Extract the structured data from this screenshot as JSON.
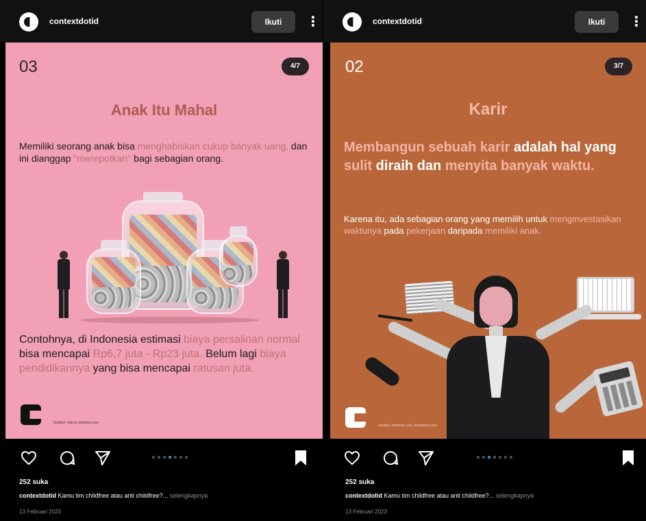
{
  "posts": [
    {
      "username": "contextdotid",
      "follow_label": "Ikuti",
      "more_glyph": "⋮",
      "slide_number": "03",
      "counter": "4/7",
      "title": "Anak Itu Mahal",
      "p1": [
        {
          "t": "Memiliki seorang anak bisa ",
          "hl": false
        },
        {
          "t": "menghabiskan cukup banyak uang,",
          "hl": true
        },
        {
          "t": " dan ini dianggap ",
          "hl": false
        },
        {
          "t": "\"merepotkan\"",
          "hl": true
        },
        {
          "t": " bagi sebagian orang.",
          "hl": false
        }
      ],
      "p2": [
        {
          "t": "Contohnya, di Indonesia estimasi ",
          "hl": false
        },
        {
          "t": "biaya persalinan normal",
          "hl": true
        },
        {
          "t": " bisa mencapai ",
          "hl": false
        },
        {
          "t": "Rp6,7 juta - Rp23 juta.",
          "hl": true
        },
        {
          "t": " Belum lagi ",
          "hl": false
        },
        {
          "t": "biaya pendidikannya",
          "hl": true
        },
        {
          "t": " yang bisa mencapai ",
          "hl": false
        },
        {
          "t": "ratusan juta.",
          "hl": true
        }
      ],
      "footnote": "Sumber: tirto.id, idntimes.com",
      "likes": "252 suka",
      "caption_user": "contextdotid",
      "caption_text": " Kamu tim childfree atau anti childfree?...",
      "caption_more": " selengkapnya",
      "date": "13 Februari 2023",
      "dots": 7,
      "active_dot": 3
    },
    {
      "username": "contextdotid",
      "follow_label": "Ikuti",
      "more_glyph": "⋮",
      "slide_number": "02",
      "counter": "3/7",
      "title": "Karir",
      "p1": [
        {
          "t": "Membangun sebuah karir",
          "hl": true
        },
        {
          "t": " adalah hal yang ",
          "hl": false
        },
        {
          "t": "sulit",
          "hl": true
        },
        {
          "t": " diraih dan ",
          "hl": false
        },
        {
          "t": "menyita banyak waktu.",
          "hl": true
        }
      ],
      "p2": [
        {
          "t": "Karena itu, ada sebagian orang yang memilih untuk ",
          "hl": false
        },
        {
          "t": "menginvestasikan waktunya",
          "hl": true
        },
        {
          "t": " pada ",
          "hl": false
        },
        {
          "t": "pekerjaan",
          "hl": true
        },
        {
          "t": " daripada ",
          "hl": false
        },
        {
          "t": "memiliki anak.",
          "hl": true
        }
      ],
      "footnote": "Sumber: idntimes.com, kumparan.com",
      "likes": "252 suka",
      "caption_user": "contextdotid",
      "caption_text": " Kamu tim childfree atau anti childfree?...",
      "caption_more": " selengkapnya",
      "date": "13 Februari 2023",
      "dots": 7,
      "active_dot": 2
    }
  ]
}
